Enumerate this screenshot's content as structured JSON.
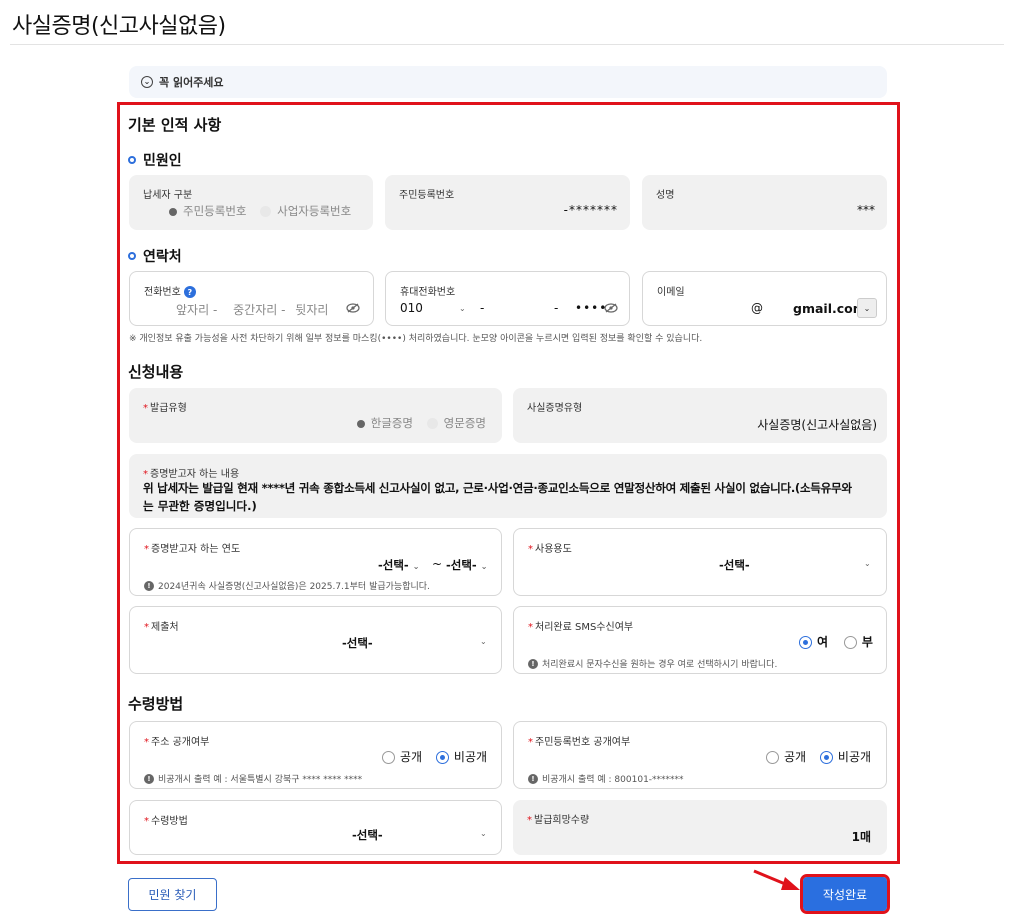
{
  "page_title": "사실증명(신고사실없음)",
  "notice": {
    "label": "꼭 읽어주세요"
  },
  "basic": {
    "heading": "기본 인적 사항",
    "applicant": {
      "heading": "민원인",
      "taxpayer_type": {
        "label": "납세자 구분",
        "option1": "주민등록번호",
        "option2": "사업자등록번호"
      },
      "resident_no": {
        "label": "주민등록번호",
        "value": "-*******"
      },
      "name": {
        "label": "성명",
        "value": "***"
      }
    },
    "contact": {
      "heading": "연락처",
      "phone": {
        "label": "전화번호",
        "help": "?",
        "part1": "앞자리",
        "sep1": "-",
        "part2": "중간자리",
        "sep2": "-",
        "part3": "뒷자리"
      },
      "mobile": {
        "label": "휴대전화번호",
        "prefix": "010",
        "sep1": "-",
        "sep2": "-",
        "last": "••••"
      },
      "email": {
        "label": "이메일",
        "at": "@",
        "domain": "gmail.com"
      },
      "privacy_note": "※ 개인정보 유출 가능성을 사전 차단하기 위해 일부 정보를 마스킹(••••) 처리하였습니다. 눈모양 아이콘을 누르시면 입력된 정보를 확인할 수 있습니다."
    }
  },
  "request": {
    "heading": "신청내용",
    "issue_type": {
      "label": "발급유형",
      "option1": "한글증명",
      "option2": "영문증명"
    },
    "cert_type": {
      "label": "사실증명유형",
      "value": "사실증명(신고사실없음)"
    },
    "content": {
      "label": "증명받고자 하는 내용",
      "line1": "위 납세자는 발급일 현재 ****년 귀속 종합소득세 신고사실이 없고, 근로·사업·연금·종교인소득으로 연말정산하여 제출된 사실이 없습니다.(소득유무와",
      "line2": "는 무관한 증명입니다.)"
    },
    "year": {
      "label": "증명받고자 하는 연도",
      "from": "-선택-",
      "tilde": "~",
      "to": "-선택-",
      "hint": "2024년귀속 사실증명(신고사실없음)은 2025.7.1부터 발급가능합니다."
    },
    "purpose": {
      "label": "사용용도",
      "value": "-선택-"
    },
    "submit_to": {
      "label": "제출처",
      "value": "-선택-"
    },
    "sms": {
      "label": "처리완료 SMS수신여부",
      "yes": "여",
      "no": "부",
      "hint": "처리완료시 문자수신을 원하는 경우 여로 선택하시기 바랍니다."
    }
  },
  "receive": {
    "heading": "수령방법",
    "address_public": {
      "label": "주소 공개여부",
      "opt1": "공개",
      "opt2": "비공개",
      "hint": "비공개시 출력 예 : 서울특별시 강북구 **** **** ****"
    },
    "resident_public": {
      "label": "주민등록번호 공개여부",
      "opt1": "공개",
      "opt2": "비공개",
      "hint": "비공개시 출력 예 : 800101-*******"
    },
    "method": {
      "label": "수령방법",
      "value": "-선택-"
    },
    "quantity": {
      "label": "발급희망수량",
      "value": "1매"
    }
  },
  "buttons": {
    "find": "민원 찾기",
    "submit": "작성완료"
  },
  "colors": {
    "accent": "#2a6fe0",
    "highlight": "#e0121b"
  }
}
